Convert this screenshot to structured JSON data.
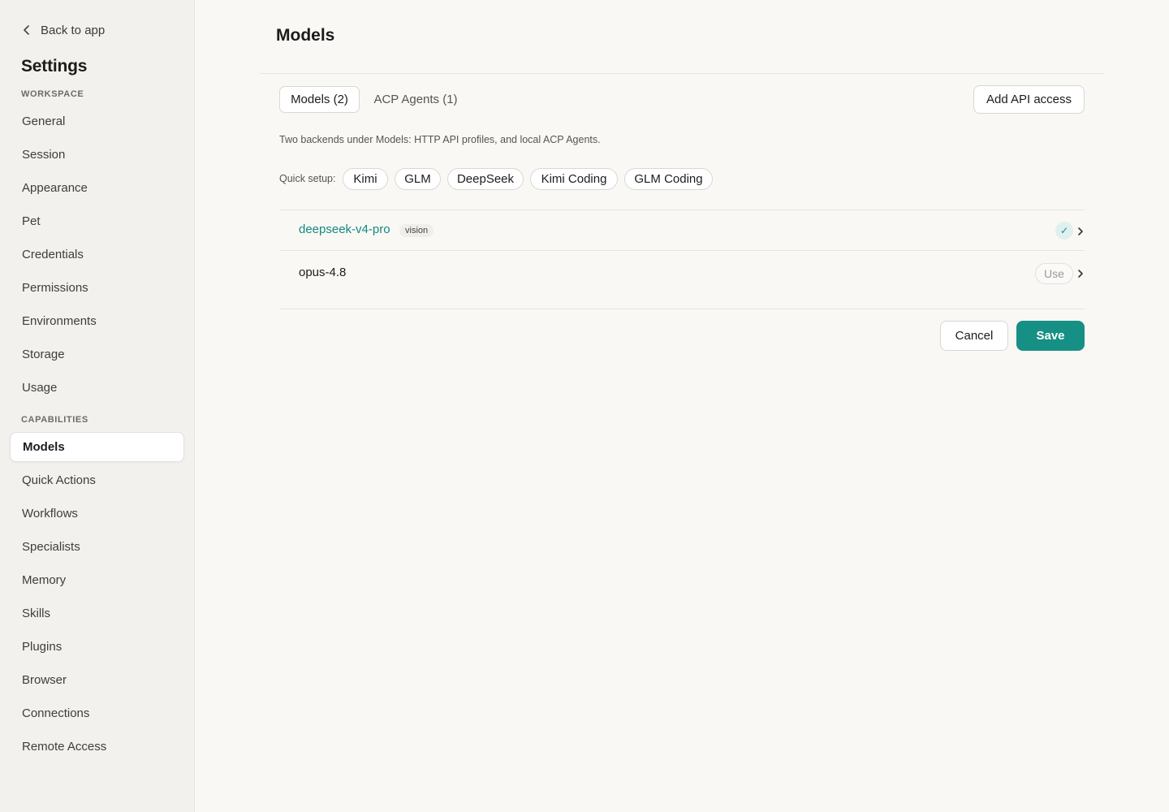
{
  "sidebar": {
    "back_label": "Back to app",
    "title": "Settings",
    "sections": [
      {
        "label": "WORKSPACE",
        "items": [
          "General",
          "Session",
          "Appearance",
          "Pet",
          "Credentials",
          "Permissions",
          "Environments",
          "Storage",
          "Usage"
        ]
      },
      {
        "label": "CAPABILITIES",
        "items": [
          "Models",
          "Quick Actions",
          "Workflows",
          "Specialists",
          "Memory",
          "Skills",
          "Plugins",
          "Browser",
          "Connections",
          "Remote Access"
        ]
      }
    ],
    "active_item": "Models"
  },
  "main": {
    "title": "Models",
    "tabs": [
      {
        "label": "Models (2)",
        "active": true
      },
      {
        "label": "ACP Agents (1)",
        "active": false
      }
    ],
    "add_button": "Add API access",
    "description": "Two backends under Models: HTTP API profiles, and local ACP Agents.",
    "quick_setup": {
      "label": "Quick setup:",
      "options": [
        "Kimi",
        "GLM",
        "DeepSeek",
        "Kimi Coding",
        "GLM Coding"
      ]
    },
    "models": [
      {
        "name": "deepseek-v4-pro",
        "badge": "vision",
        "selected": true,
        "status_icon": "check-icon"
      },
      {
        "name": "opus-4.8",
        "badge": "",
        "selected": false,
        "action": "Use"
      }
    ],
    "cancel_label": "Cancel",
    "save_label": "Save"
  },
  "colors": {
    "accent": "#168f84",
    "accent_text": "#138a80",
    "sidebar_bg": "#f2f1ed",
    "main_bg": "#f9f8f5"
  }
}
